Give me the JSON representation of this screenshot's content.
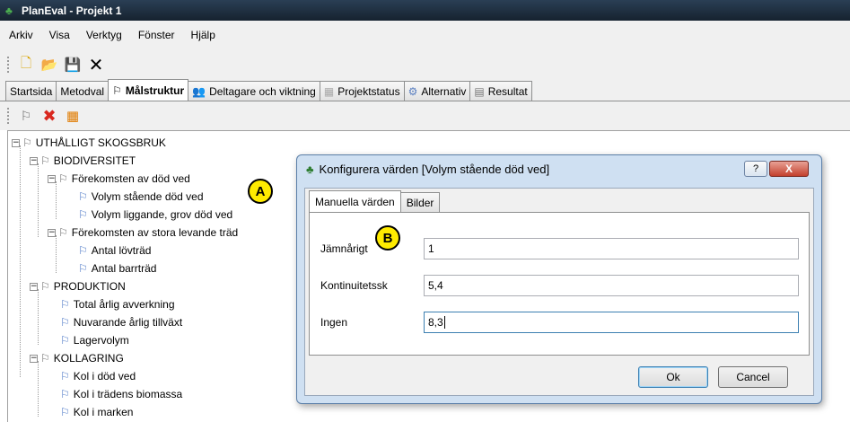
{
  "window": {
    "title": "PlanEval - Projekt 1"
  },
  "menu": {
    "items": [
      "Arkiv",
      "Visa",
      "Verktyg",
      "Fönster",
      "Hjälp"
    ]
  },
  "tabs": [
    {
      "label": "Startsida"
    },
    {
      "label": "Metodval"
    },
    {
      "label": "Målstruktur"
    },
    {
      "label": "Deltagare och viktning"
    },
    {
      "label": "Projektstatus"
    },
    {
      "label": "Alternativ"
    },
    {
      "label": "Resultat"
    }
  ],
  "tree": [
    {
      "label": "UTHÅLLIGT SKOGSBRUK"
    },
    {
      "label": "BIODIVERSITET"
    },
    {
      "label": "Förekomsten av död ved"
    },
    {
      "label": "Volym stående död ved"
    },
    {
      "label": "Volym liggande, grov död ved"
    },
    {
      "label": "Förekomsten av stora levande träd"
    },
    {
      "label": "Antal lövträd"
    },
    {
      "label": "Antal barrträd"
    },
    {
      "label": "PRODUKTION"
    },
    {
      "label": "Total årlig avverkning"
    },
    {
      "label": "Nuvarande årlig tillväxt"
    },
    {
      "label": "Lagervolym"
    },
    {
      "label": "KOLLAGRING"
    },
    {
      "label": "Kol i död ved"
    },
    {
      "label": "Kol i trädens biomassa"
    },
    {
      "label": "Kol i marken"
    }
  ],
  "markers": {
    "a": "A",
    "b": "B"
  },
  "dialog": {
    "title": "Konfigurera värden [Volym stående död ved]",
    "help": "?",
    "close": "X",
    "tabs": [
      "Manuella värden",
      "Bilder"
    ],
    "fields": [
      {
        "label": "Jämnårigt",
        "value": "1"
      },
      {
        "label": "Kontinuitetssk",
        "value": "5,4"
      },
      {
        "label": "Ingen",
        "value": "8,3"
      }
    ],
    "ok": "Ok",
    "cancel": "Cancel"
  }
}
